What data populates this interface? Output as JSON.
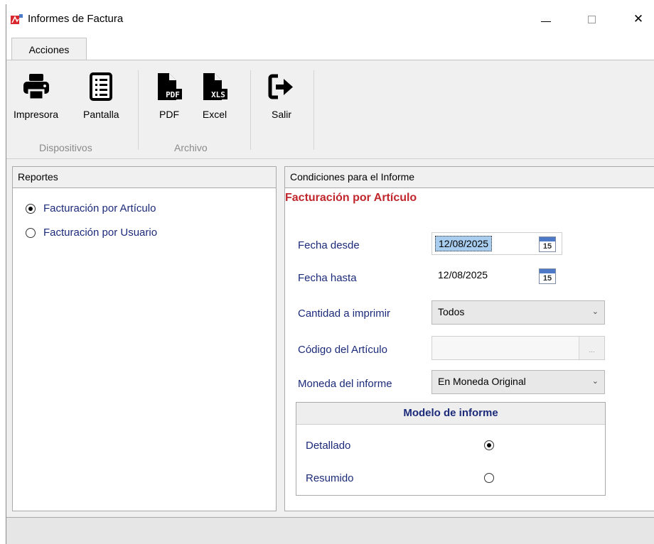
{
  "window": {
    "title": "Informes de Factura",
    "close_glyph": "✕"
  },
  "ribbon": {
    "tab_label": "Acciones",
    "buttons": [
      {
        "label": "Impresora",
        "icon": "printer-icon"
      },
      {
        "label": "Pantalla",
        "icon": "report-list-icon"
      },
      {
        "label": "PDF",
        "icon": "pdf-file-icon"
      },
      {
        "label": "Excel",
        "icon": "xls-file-icon"
      },
      {
        "label": "Salir",
        "icon": "exit-icon"
      }
    ],
    "groups": [
      "Dispositivos",
      "Archivo"
    ],
    "pdf_badge": "PDF",
    "xls_badge": "XLS"
  },
  "reportes": {
    "header": "Reportes",
    "options": [
      {
        "label": "Facturación por Artículo",
        "checked": true
      },
      {
        "label": "Facturación por Usuario",
        "checked": false
      }
    ]
  },
  "condiciones": {
    "header": "Condiciones para el Informe",
    "title": "Facturación por Artículo",
    "fecha_desde_label": "Fecha desde",
    "fecha_desde_value": "12/08/2025",
    "fecha_hasta_label": "Fecha hasta",
    "fecha_hasta_value": "12/08/2025",
    "calendar_day": "15",
    "cantidad_label": "Cantidad a imprimir",
    "cantidad_value": "Todos",
    "codigo_label": "Código del Artículo",
    "codigo_value": "",
    "codigo_button": "...",
    "moneda_label": "Moneda del informe",
    "moneda_value": "En Moneda Original",
    "combo_arrow": "⌄"
  },
  "modelo": {
    "header": "Modelo de informe",
    "options": [
      {
        "label": "Detallado",
        "checked": true
      },
      {
        "label": "Resumido",
        "checked": false
      }
    ]
  },
  "colors": {
    "accent_red": "#c0262c",
    "label_blue": "#1c2a7a",
    "selection": "#a9cdee"
  }
}
